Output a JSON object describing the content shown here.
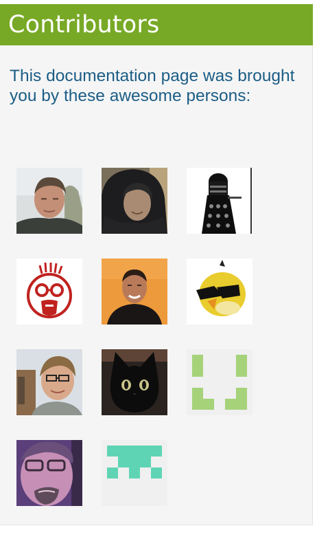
{
  "header": {
    "title": "Contributors"
  },
  "intro": {
    "text": "This documentation page was brought you by these awesome persons:"
  },
  "contributors": [
    {
      "icon": "man-photo-avatar"
    },
    {
      "icon": "hooded-person-avatar"
    },
    {
      "icon": "dalek-avatar"
    },
    {
      "icon": "cartoon-face-avatar"
    },
    {
      "icon": "smiling-man-avatar"
    },
    {
      "icon": "angry-bird-avatar"
    },
    {
      "icon": "glasses-man-avatar"
    },
    {
      "icon": "black-cat-avatar"
    },
    {
      "icon": "green-identicon-avatar"
    },
    {
      "icon": "purple-face-avatar"
    },
    {
      "icon": "teal-identicon-avatar"
    }
  ],
  "colors": {
    "header_bg": "#78a926",
    "header_text": "#ffffff",
    "intro_text": "#1b5d86",
    "panel_bg": "#f5f5f5"
  }
}
